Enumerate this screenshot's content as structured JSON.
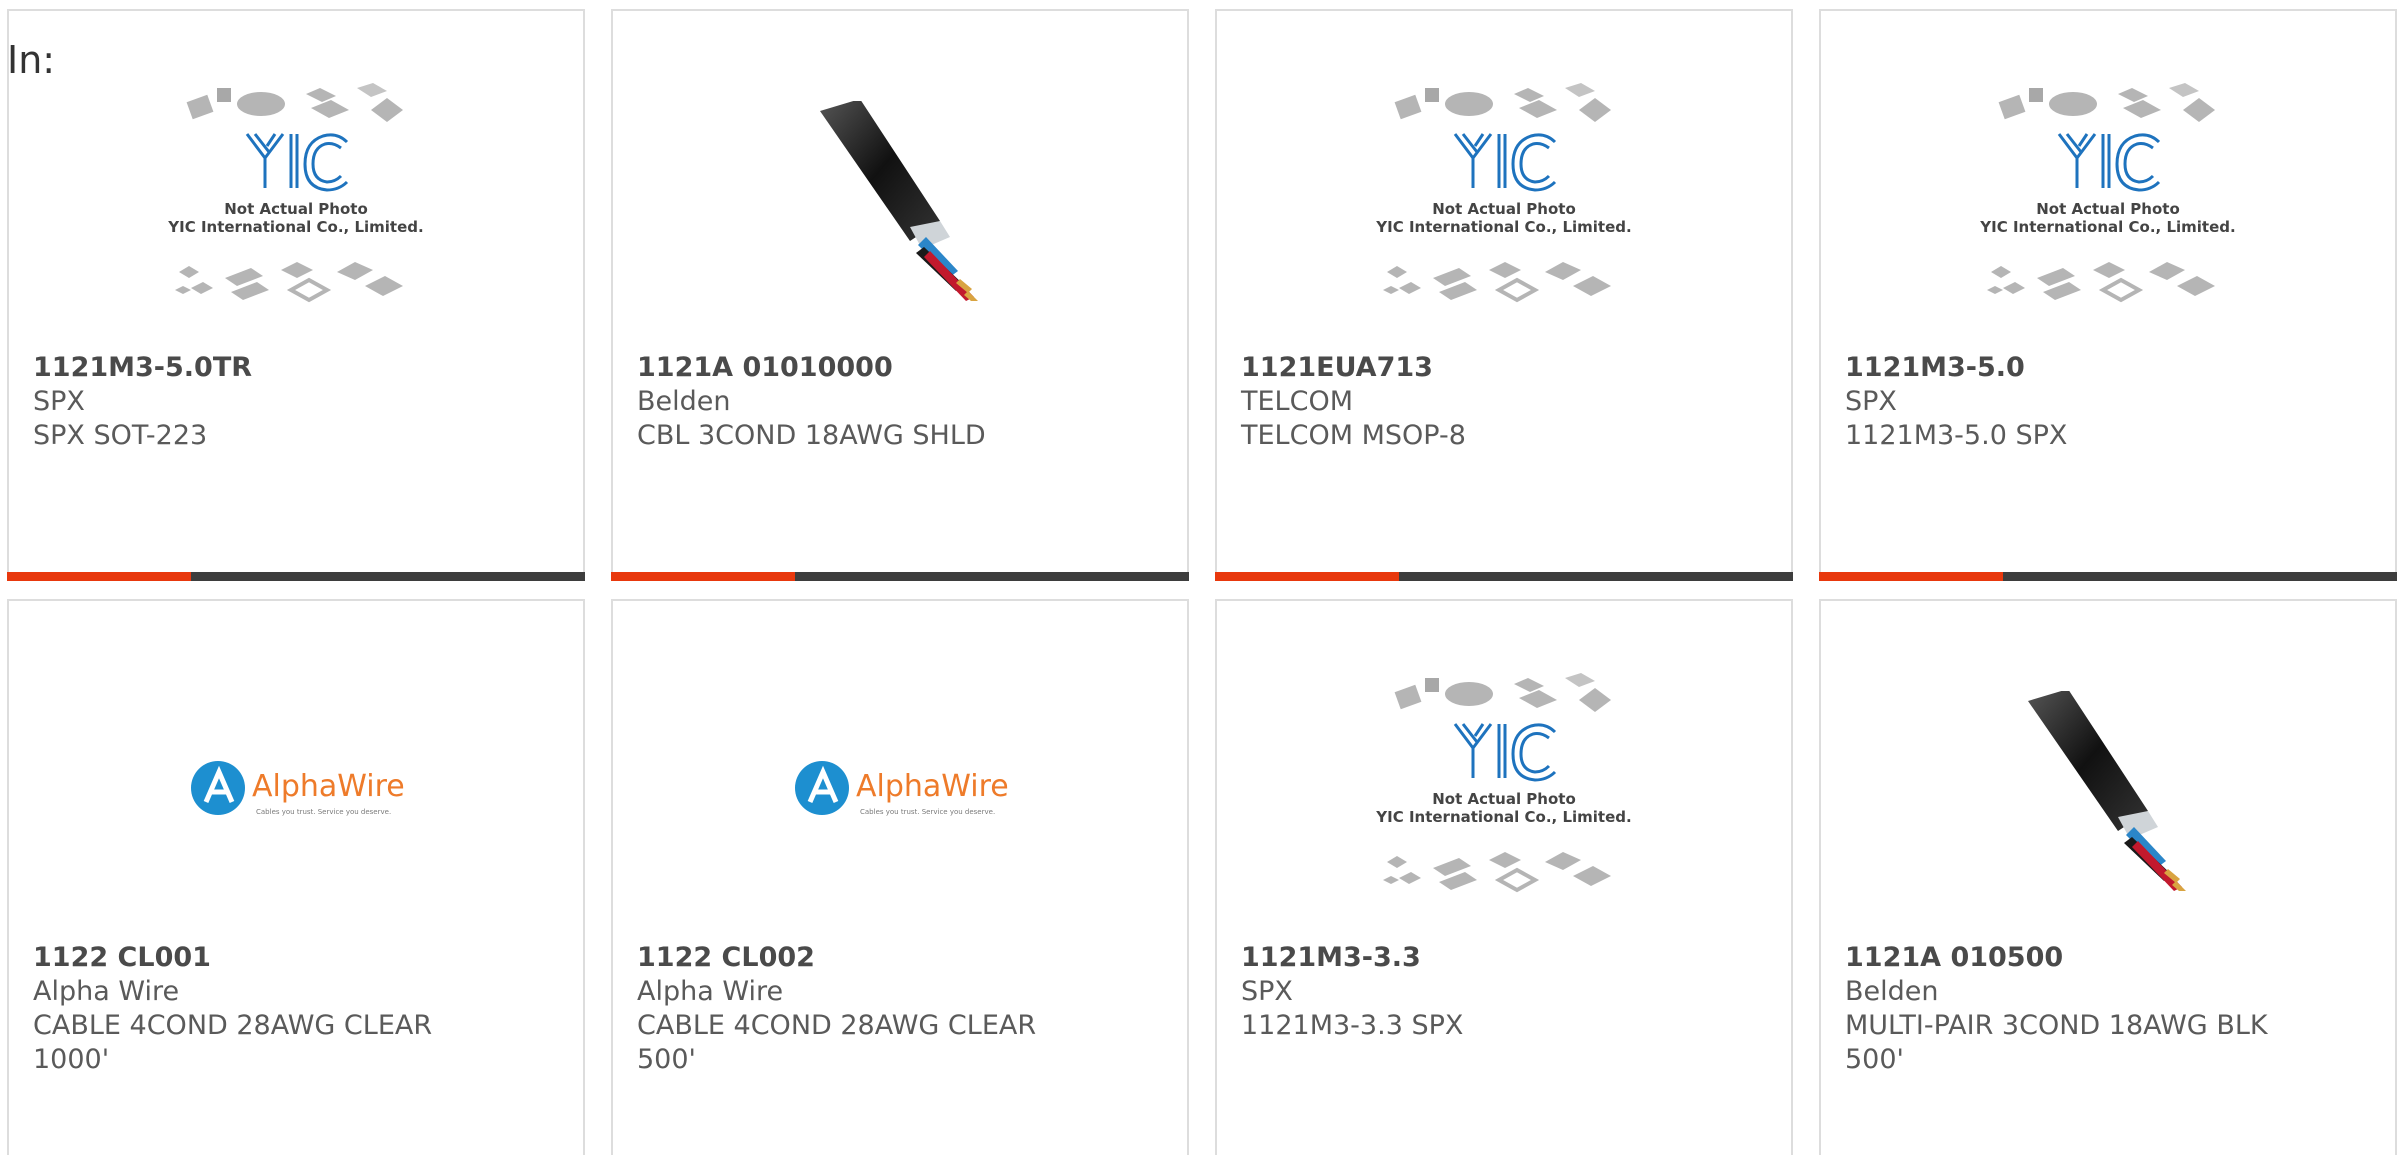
{
  "header": {
    "in_label": "In:"
  },
  "placeholder": {
    "line1": "Not Actual Photo",
    "line2": "YIC International Co., Limited.",
    "logo_text": "YIC"
  },
  "alphawire": {
    "brand": "AlphaWire",
    "tagline": "Cables you trust. Service you deserve."
  },
  "accent_color": "#e8380d",
  "bar_color": "#3d3d3d",
  "products": [
    {
      "part": "1121M3-5.0TR",
      "maker": "SPX",
      "desc": "SPX SOT-223",
      "desc2": "",
      "image": "yic-placeholder"
    },
    {
      "part": "1121A 01010000",
      "maker": "Belden",
      "desc": "CBL 3COND 18AWG SHLD",
      "desc2": "",
      "image": "cable-photo"
    },
    {
      "part": "1121EUA713",
      "maker": "TELCOM",
      "desc": "TELCOM MSOP-8",
      "desc2": "",
      "image": "yic-placeholder"
    },
    {
      "part": "1121M3-5.0",
      "maker": "SPX",
      "desc": "1121M3-5.0 SPX",
      "desc2": "",
      "image": "yic-placeholder"
    },
    {
      "part": "1122 CL001",
      "maker": "Alpha Wire",
      "desc": "CABLE 4COND 28AWG CLEAR",
      "desc2": "1000'",
      "image": "alphawire-logo"
    },
    {
      "part": "1122 CL002",
      "maker": "Alpha Wire",
      "desc": "CABLE 4COND 28AWG CLEAR",
      "desc2": "500'",
      "image": "alphawire-logo"
    },
    {
      "part": "1121M3-3.3",
      "maker": "SPX",
      "desc": "1121M3-3.3 SPX",
      "desc2": "",
      "image": "yic-placeholder"
    },
    {
      "part": "1121A 010500",
      "maker": "Belden",
      "desc": "MULTI-PAIR 3COND 18AWG BLK",
      "desc2": "500'",
      "image": "cable-photo"
    }
  ]
}
